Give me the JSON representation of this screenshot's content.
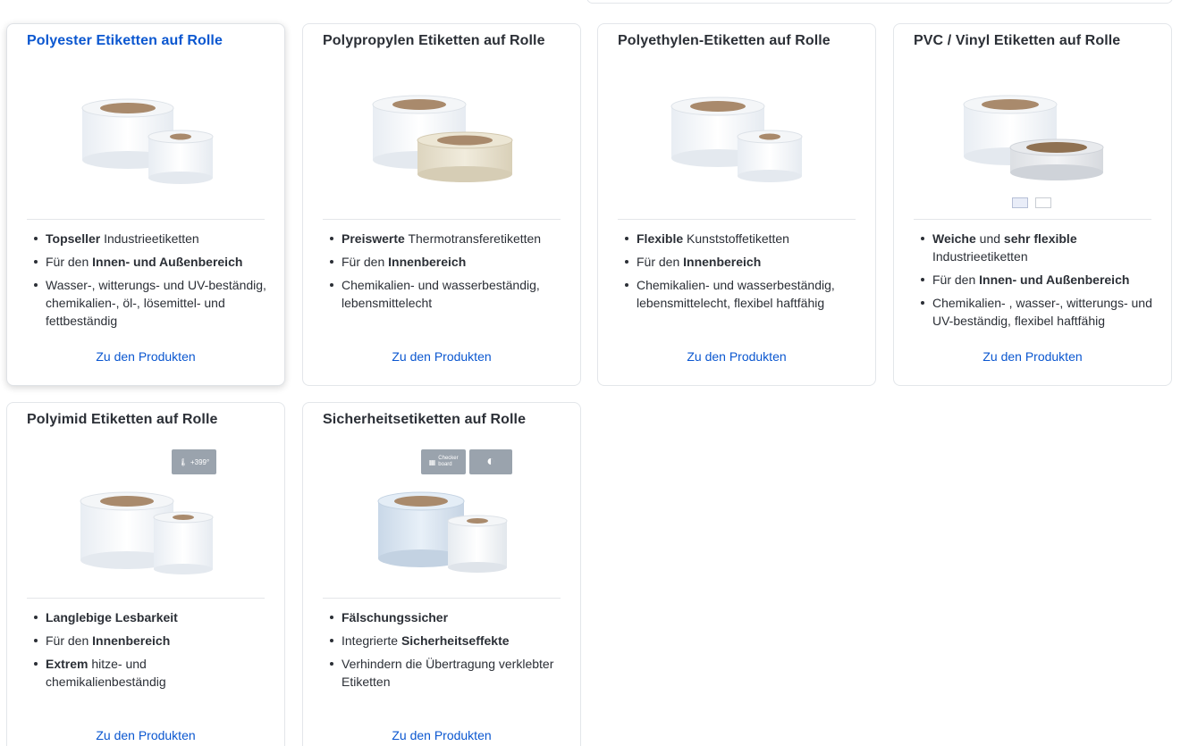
{
  "cards": [
    {
      "title": "Polyester Etiketten auf Rolle",
      "features": [
        {
          "bold": "Topseller",
          "text": " Industrieetiketten"
        },
        {
          "text": "Für den ",
          "bold": "Innen- und Außenbereich"
        },
        {
          "text": "Wasser-, witterungs- und UV-beständig, chemikalien-, öl-, lösemittel- und fettbeständig"
        }
      ],
      "cta": "Zu den Produkten"
    },
    {
      "title": "Polypropylen Etiketten auf Rolle",
      "features": [
        {
          "bold": "Preiswerte",
          "text": " Thermotransferetiketten"
        },
        {
          "text": "Für den ",
          "bold": "Innenbereich"
        },
        {
          "text": "Chemikalien- und wasserbeständig, lebensmittelecht"
        }
      ],
      "cta": "Zu den Produkten"
    },
    {
      "title": "Polyethylen-Etiketten auf Rolle",
      "features": [
        {
          "bold": "Flexible",
          "text": " Kunststoffetiketten"
        },
        {
          "text": "Für den ",
          "bold": "Innenbereich"
        },
        {
          "text": "Chemikalien- und wasserbeständig, lebensmittelecht, flexibel haftfähig"
        }
      ],
      "cta": "Zu den Produkten"
    },
    {
      "title": "PVC / Vinyl Etiketten auf Rolle",
      "features": [
        {
          "bold": "Weiche",
          "text": " und ",
          "bold2": "sehr flexible",
          "text2": " Industrieetiketten"
        },
        {
          "text": "Für den ",
          "bold": "Innen- und Außenbereich"
        },
        {
          "text": "Chemikalien- , wasser-, witterungs- und UV-beständig, flexibel haftfähig"
        }
      ],
      "cta": "Zu den Produkten"
    },
    {
      "title": "Polyimid Etiketten auf Rolle",
      "badge": "+399°",
      "features": [
        {
          "bold": "Langlebige Lesbarkeit"
        },
        {
          "text": "Für den ",
          "bold": "Innenbereich"
        },
        {
          "bold": "Extrem",
          "text": " hitze- und chemikalienbeständig"
        }
      ],
      "cta": "Zu den Produkten"
    },
    {
      "title": "Sicherheitsetiketten auf Rolle",
      "badge": "Checker board",
      "features": [
        {
          "bold": "Fälschungssicher"
        },
        {
          "text": "Integrierte ",
          "bold": "Sicherheitseffekte"
        },
        {
          "text": "Verhindern die Übertragung verklebter Etiketten"
        }
      ],
      "cta": "Zu den Produkten"
    }
  ]
}
